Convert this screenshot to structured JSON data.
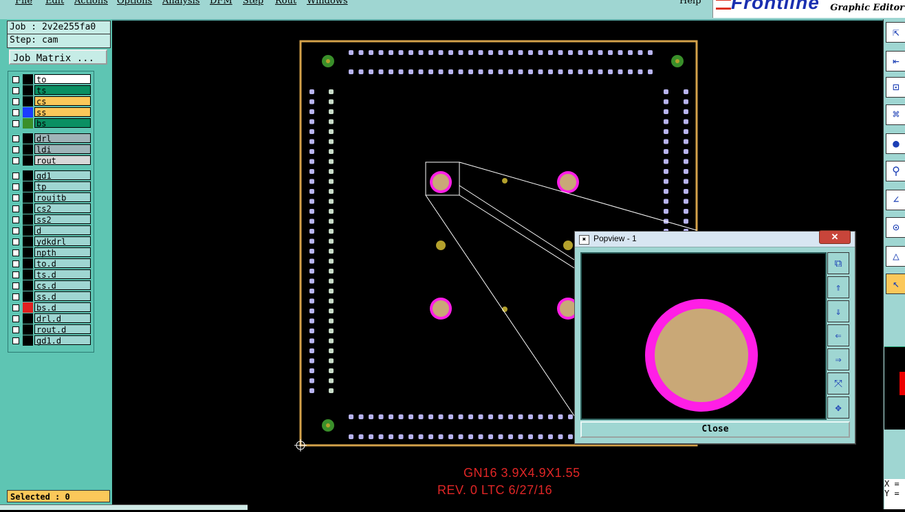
{
  "menubar": {
    "items": [
      "File",
      "Edit",
      "Actions",
      "Options",
      "Analysis",
      "DFM",
      "Step",
      "Rout",
      "Windows"
    ],
    "help": "Help"
  },
  "brand": {
    "logo": "Frontline",
    "product": "Graphic Editor"
  },
  "job": {
    "name": "Job : 2v2e255fa0",
    "step": "Step: cam",
    "matrix_button": "Job Matrix ..."
  },
  "layers": [
    {
      "name": "to",
      "bg": "#ffffff",
      "swatch": "#000000",
      "mark": "↵"
    },
    {
      "name": "ts",
      "bg": "#0a8f62",
      "swatch": "#000000",
      "mark": ""
    },
    {
      "name": "cs",
      "bg": "#fbc85a",
      "swatch": "#000000",
      "mark": ""
    },
    {
      "name": "ss",
      "bg": "#fbc85a",
      "swatch": "#1a3cff",
      "mark": ""
    },
    {
      "name": "bs",
      "bg": "#0a8f62",
      "swatch": "#3a8f2a",
      "mark": ""
    },
    {
      "name": "drl",
      "bg": "#9fb4b8",
      "swatch": "#000000",
      "mark": ""
    },
    {
      "name": "ldi",
      "bg": "#9fb4b8",
      "swatch": "#000000",
      "mark": ""
    },
    {
      "name": "rout",
      "bg": "#d8d8d8",
      "swatch": "#000000",
      "mark": ""
    },
    {
      "name": "gd1",
      "bg": "#9fd6d2",
      "swatch": "#000000",
      "mark": "↵"
    },
    {
      "name": "tp",
      "bg": "#9fd6d2",
      "swatch": "#000000",
      "mark": ""
    },
    {
      "name": "roujtb",
      "bg": "#9fd6d2",
      "swatch": "#000000",
      "mark": ""
    },
    {
      "name": "cs2",
      "bg": "#9fd6d2",
      "swatch": "#000000",
      "mark": ""
    },
    {
      "name": "ss2",
      "bg": "#9fd6d2",
      "swatch": "#000000",
      "mark": ""
    },
    {
      "name": "d",
      "bg": "#9fd6d2",
      "swatch": "#000000",
      "mark": ""
    },
    {
      "name": "ydkdrl",
      "bg": "#9fd6d2",
      "swatch": "#000000",
      "mark": ""
    },
    {
      "name": "npth",
      "bg": "#9fd6d2",
      "swatch": "#000000",
      "mark": ""
    },
    {
      "name": "to.d",
      "bg": "#9fd6d2",
      "swatch": "#000000",
      "mark": "↵"
    },
    {
      "name": "ts.d",
      "bg": "#9fd6d2",
      "swatch": "#000000",
      "mark": ""
    },
    {
      "name": "cs.d",
      "bg": "#9fd6d2",
      "swatch": "#000000",
      "mark": ""
    },
    {
      "name": "ss.d",
      "bg": "#9fd6d2",
      "swatch": "#000000",
      "mark": ""
    },
    {
      "name": "bs.d",
      "bg": "#9fd6d2",
      "swatch": "#e02020",
      "mark": "⊞"
    },
    {
      "name": "drl.d",
      "bg": "#9fd6d2",
      "swatch": "#000000",
      "mark": ""
    },
    {
      "name": "rout.d",
      "bg": "#9fd6d2",
      "swatch": "#000000",
      "mark": ""
    },
    {
      "name": "gd1.d",
      "bg": "#9fd6d2",
      "swatch": "#000000",
      "mark": ""
    }
  ],
  "status": {
    "selected": "Selected : 0"
  },
  "popview": {
    "title": "Popview - 1",
    "close_label": "Close",
    "close_x": "✕"
  },
  "board": {
    "line1": "GN16  3.9X4.9X1.55",
    "line2": "REV. 0   LTC 6/27/16"
  },
  "coords": {
    "x_label": "X =",
    "y_label": "Y ="
  },
  "colors": {
    "panel": "#5ec5b3",
    "board_outline": "#d4a24a",
    "pad_ring": "#ff1ee6",
    "pad_fill": "#c9a877",
    "smd": "#b8b4f0"
  }
}
